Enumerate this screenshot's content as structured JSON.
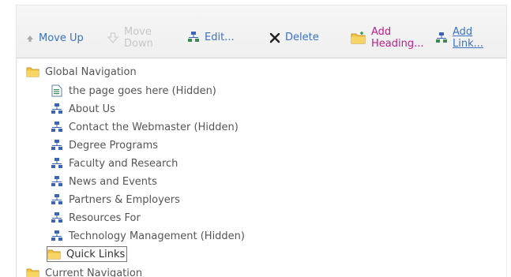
{
  "toolbar": {
    "move_up": {
      "label": "Move Up",
      "icon": "up-arrow-icon"
    },
    "move_down": {
      "label_line1": "Move",
      "label_line2": "Down",
      "icon": "down-arrow-icon"
    },
    "edit": {
      "label": "Edit...",
      "icon": "edit-node-icon"
    },
    "delete": {
      "label": "Delete",
      "icon": "x-delete-icon"
    },
    "add_heading": {
      "label_line1": "Add",
      "label_line2": "Heading...",
      "icon": "folder-add-icon"
    },
    "add_link": {
      "label_line1": "Add",
      "label_line2": "Link...",
      "icon": "link-add-icon"
    }
  },
  "tree": {
    "global_nav": {
      "label": "Global Navigation",
      "icon": "folder-icon"
    },
    "items": [
      {
        "label": "the page goes here (Hidden)",
        "icon": "page-icon"
      },
      {
        "label": "About Us",
        "icon": "sitemap-icon"
      },
      {
        "label": "Contact the Webmaster (Hidden)",
        "icon": "sitemap-icon"
      },
      {
        "label": "Degree Programs",
        "icon": "sitemap-icon"
      },
      {
        "label": "Faculty and Research",
        "icon": "sitemap-icon"
      },
      {
        "label": "News and Events",
        "icon": "sitemap-icon"
      },
      {
        "label": "Partners & Employers",
        "icon": "sitemap-icon"
      },
      {
        "label": "Resources For",
        "icon": "sitemap-icon"
      },
      {
        "label": "Technology Management (Hidden)",
        "icon": "sitemap-icon"
      }
    ],
    "quick_links": {
      "label": "Quick Links",
      "icon": "folder-icon"
    },
    "current_nav": {
      "label": "Current Navigation",
      "icon": "folder-icon"
    }
  },
  "colors": {
    "link_blue": "#3a72c4",
    "disabled_gray": "#c7c7c7",
    "magenta": "#c21b8a",
    "folder_yellow": "#f3c53d",
    "sitemap_blue": "#3b63b8"
  }
}
